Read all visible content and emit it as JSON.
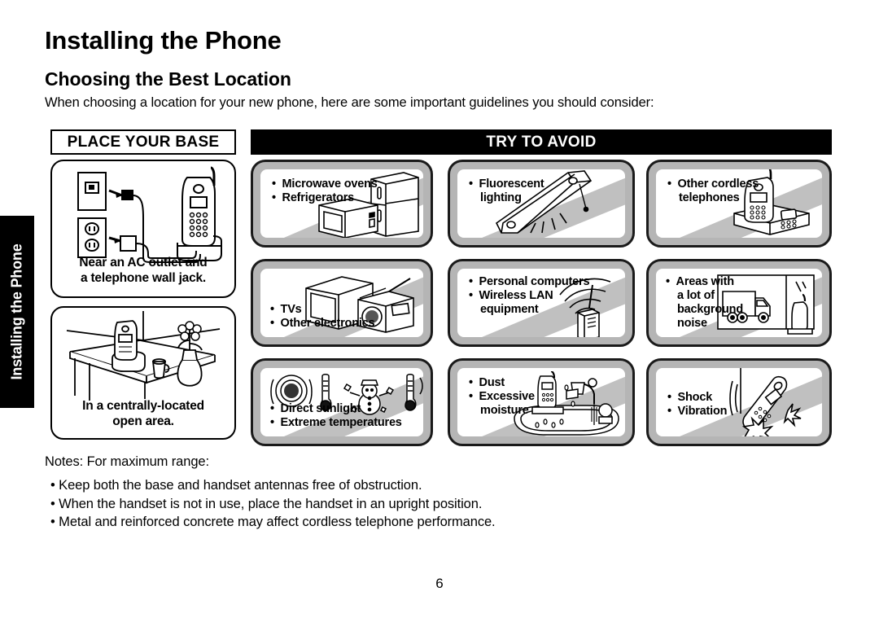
{
  "page": {
    "title": "Installing the Phone",
    "section_title": "Choosing the Best Location",
    "intro": "When choosing a location for your new phone, here are some important guidelines you should consider:",
    "number": "6"
  },
  "side_tab": {
    "label": "Installing the Phone",
    "background_color": "#000000",
    "text_color": "#ffffff"
  },
  "columns": {
    "base_heading": "PLACE YOUR BASE",
    "avoid_heading": "TRY TO AVOID"
  },
  "base_cards": [
    {
      "caption_line1": "Near an AC outlet and",
      "caption_line2": "a telephone wall jack.",
      "art": "ac-outlet-and-phone-jack-illustration"
    },
    {
      "caption_line1": "In a centrally-located",
      "caption_line2": "open area.",
      "art": "table-in-open-room-illustration"
    }
  ],
  "avoid_cards": [
    {
      "items": [
        "Microwave ovens",
        "Refrigerators"
      ],
      "art": "microwave-and-refrigerator-illustration"
    },
    {
      "items": [
        "Fluorescent",
        "lighting"
      ],
      "continuation": true,
      "art": "fluorescent-light-fixture-illustration"
    },
    {
      "items": [
        "Other cordless",
        "telephones"
      ],
      "continuation": true,
      "art": "cordless-telephone-base-illustration"
    },
    {
      "items": [
        "TVs",
        "Other electronics"
      ],
      "art": "tv-and-radio-illustration"
    },
    {
      "items": [
        "Personal computers",
        "Wireless LAN",
        "equipment"
      ],
      "continuation": true,
      "art": "wireless-router-signal-illustration"
    },
    {
      "items": [
        "Areas with",
        "a lot of",
        "background",
        "noise"
      ],
      "continuation": true,
      "art": "truck-outside-window-illustration"
    },
    {
      "items": [
        "Direct sunlight",
        "Extreme temperatures"
      ],
      "art": "sun-snowman-thermometers-illustration"
    },
    {
      "items": [
        "Dust",
        "Excessive",
        "moisture"
      ],
      "continuation": true,
      "art": "sink-faucet-water-illustration"
    },
    {
      "items": [
        "Shock",
        "Vibration"
      ],
      "art": "dropped-handset-impact-illustration"
    }
  ],
  "notes": {
    "lead": "Notes: For maximum range:",
    "items": [
      "Keep both the base and handset antennas free of obstruction.",
      "When the handset is not in use, place the handset in an upright position.",
      "Metal and reinforced concrete may affect cordless telephone performance."
    ]
  },
  "colors": {
    "card_border": "#1a1a1a",
    "card_frame": "#b5b5b5",
    "slash": "#c0c0c0",
    "ink": "#000000",
    "paper": "#ffffff"
  }
}
